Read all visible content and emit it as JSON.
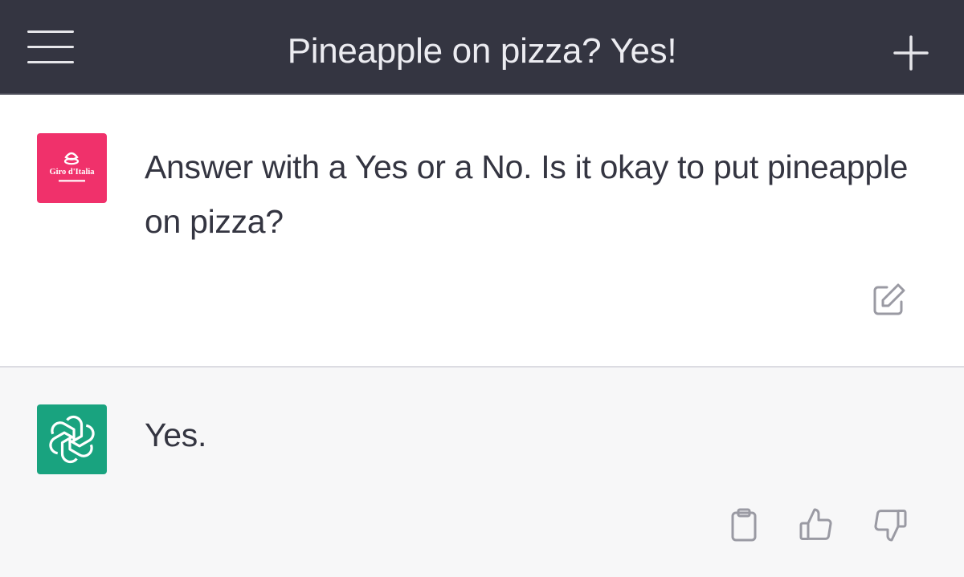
{
  "header": {
    "title": "Pineapple on pizza? Yes!",
    "menu_icon": "hamburger-menu-icon",
    "new_chat_icon": "plus-icon",
    "background": "#343541"
  },
  "conversation": {
    "user_message": {
      "avatar_text": "Giro d'Italia",
      "avatar_color": "#f0316b",
      "text": "Answer with a Yes or a No. Is it okay to put pineapple on pizza?",
      "edit_icon": "edit-icon"
    },
    "assistant_message": {
      "avatar_icon": "openai-logo-icon",
      "avatar_color": "#19a37f",
      "text": "Yes.",
      "actions": [
        "clipboard-icon",
        "thumbs-up-icon",
        "thumbs-down-icon"
      ]
    }
  }
}
